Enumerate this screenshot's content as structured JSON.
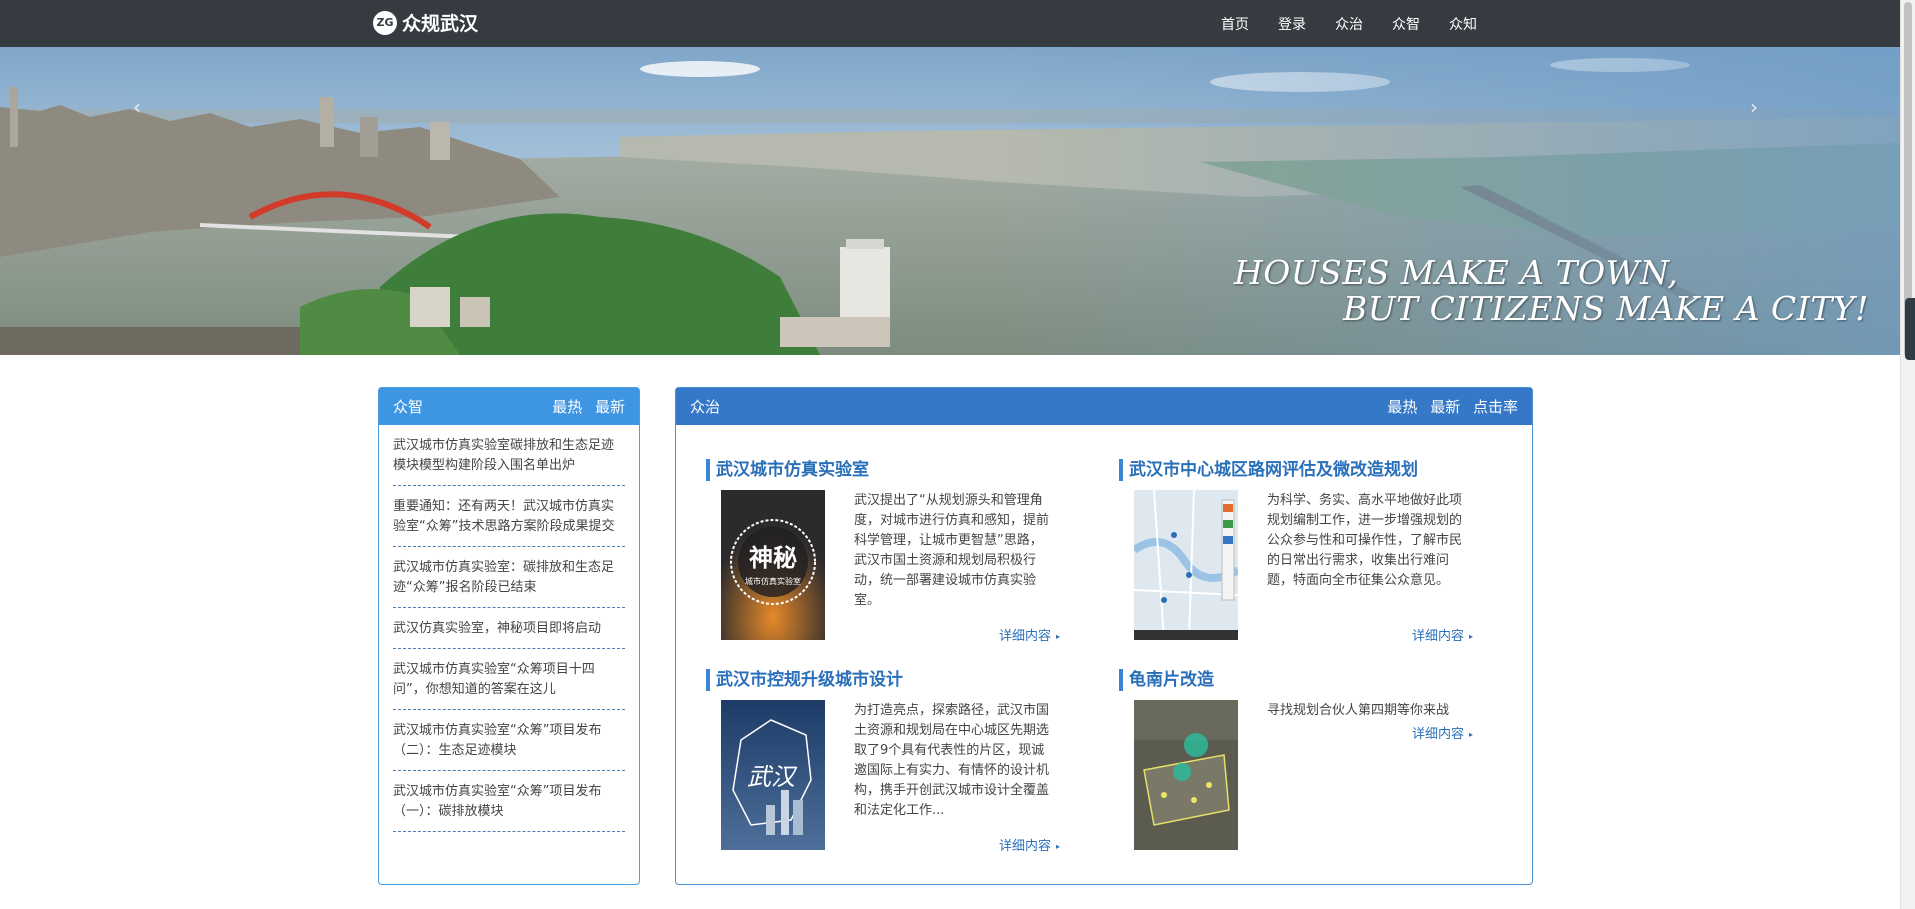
{
  "header": {
    "logo_badge": "ZG",
    "site_name": "众规武汉",
    "nav": [
      "首页",
      "登录",
      "众治",
      "众智",
      "众知"
    ]
  },
  "banner": {
    "slogan_line1": "HOUSES MAKE A TOWN,",
    "slogan_line2": "BUT CITIZENS MAKE A CITY!",
    "prev_arrow": "‹",
    "next_arrow": "›",
    "slide_count": 4,
    "active_slide": 3
  },
  "zhongzhi_panel": {
    "title": "众智",
    "tabs": [
      "最热",
      "最新"
    ],
    "items": [
      "武汉城市仿真实验室碳排放和生态足迹模块模型构建阶段入围名单出炉",
      "重要通知：还有两天！武汉城市仿真实验室“众筹”技术思路方案阶段成果提交",
      "武汉城市仿真实验室：碳排放和生态足迹“众筹”报名阶段已结束",
      "武汉仿真实验室，神秘项目即将启动",
      "武汉城市仿真实验室“众筹项目十四问”，你想知道的答案在这儿",
      "武汉城市仿真实验室“众筹”项目发布（二）：生态足迹模块",
      "武汉城市仿真实验室“众筹”项目发布（一）：碳排放模块"
    ]
  },
  "zhongzhi2_panel": {
    "title": "众治",
    "tabs": [
      "最热",
      "最新",
      "点击率"
    ],
    "more_label": "详细内容",
    "cards": [
      {
        "title": "武汉城市仿真实验室",
        "description": "武汉提出了“从规划源头和管理角度，对城市进行仿真和感知，提前科学管理，让城市更智慧”思路，武汉市国土资源和规划局积极行动，统一部署建设城市仿真实验室。",
        "image_text_main": "神秘",
        "image_text_sub": "城市仿真实验室"
      },
      {
        "title": "武汉市中心城区路网评估及微改造规划",
        "description": "为科学、务实、高水平地做好此项规划编制工作，进一步增强规划的公众参与性和可操作性，了解市民的日常出行需求，收集出行难问题，特面向全市征集公众意见。"
      },
      {
        "title": "武汉市控规升级城市设计",
        "description": "为打造亮点，探索路径，武汉市国土资源和规划局在中心城区先期选取了9个具有代表性的片区，现诚邀国际上有实力、有情怀的设计机构，携手开创武汉城市设计全覆盖和法定化工作...",
        "image_text_main": "武汉"
      },
      {
        "title": "龟南片改造",
        "description": "寻找规划合伙人第四期等你来战"
      }
    ]
  },
  "colors": {
    "topbar": "#353b41",
    "left_panel_head": "#3e95e2",
    "right_panel_head": "#3478c7",
    "accent_text": "#2a6fba"
  }
}
